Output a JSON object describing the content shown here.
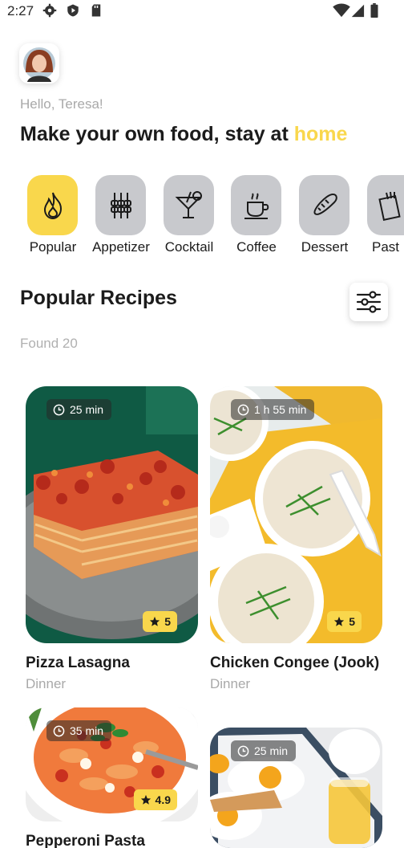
{
  "status_bar": {
    "time": "2:27",
    "icons": [
      "gear-icon",
      "shield-icon",
      "sd-card-icon",
      "wifi-icon",
      "signal-icon",
      "battery-icon"
    ]
  },
  "header": {
    "greeting": "Hello, Teresa!",
    "headline_main": "Make your own food, stay at ",
    "headline_accent": "home"
  },
  "colors": {
    "accent": "#f9d74c",
    "category_bg": "#c8c9cd",
    "muted_text": "#a9a9a9"
  },
  "categories": [
    {
      "label": "Popular",
      "icon": "flame-icon",
      "active": true
    },
    {
      "label": "Appetizer",
      "icon": "skewers-icon",
      "active": false
    },
    {
      "label": "Cocktail",
      "icon": "cocktail-glass-icon",
      "active": false
    },
    {
      "label": "Coffee",
      "icon": "coffee-cup-icon",
      "active": false
    },
    {
      "label": "Dessert",
      "icon": "bread-icon",
      "active": false
    },
    {
      "label": "Past",
      "icon": "pasta-box-icon",
      "active": false
    }
  ],
  "section": {
    "title": "Popular Recipes",
    "found": "Found 20",
    "filter_icon": "sliders-icon"
  },
  "recipes": [
    {
      "title": "Pizza Lasagna",
      "category": "Dinner",
      "time": "25 min",
      "rating": "5"
    },
    {
      "title": "Chicken Congee (Jook)",
      "category": "Dinner",
      "time": "1 h 55 min",
      "rating": "5"
    },
    {
      "title": "Pepperoni Pasta",
      "category": "",
      "time": "35 min",
      "rating": "4.9"
    },
    {
      "title": "",
      "category": "",
      "time": "25 min",
      "rating": ""
    }
  ]
}
